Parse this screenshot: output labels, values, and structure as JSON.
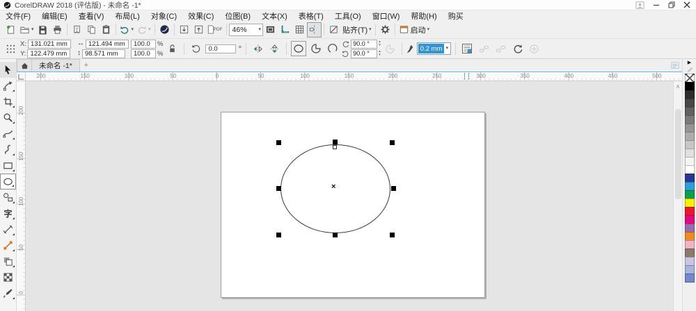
{
  "window": {
    "title": "CorelDRAW 2018 (评估版) - 未命名 -1*"
  },
  "menubar": {
    "items": [
      "文件(F)",
      "编辑(E)",
      "查看(V)",
      "布局(L)",
      "对象(C)",
      "效果(C)",
      "位图(B)",
      "文本(X)",
      "表格(T)",
      "工具(O)",
      "窗口(W)",
      "帮助(H)",
      "购买"
    ]
  },
  "toolbar": {
    "zoom_level": "46%",
    "pdf_label": "PDF",
    "snap_label": "贴齐(T)",
    "launch_label": "启动"
  },
  "property_bar": {
    "x_label": "X:",
    "x_value": "131.021 mm",
    "y_label": "Y:",
    "y_value": "122.479 mm",
    "width_value": "121.494 mm",
    "height_value": "98.571 mm",
    "scale_h": "100.0",
    "scale_v": "100.0",
    "percent": "%",
    "rotation_value": "0.0",
    "start_angle": "90.0 °",
    "end_angle": "90.0 °",
    "outline_width": "0.2 mm"
  },
  "document_tabs": {
    "active": "未命名 -1*"
  },
  "rulers": {
    "horizontal_labels": [
      "200",
      "150",
      "100",
      "50",
      "0",
      "50",
      "100",
      "150",
      "200",
      "250",
      "300",
      "350",
      "400",
      "450",
      "500"
    ],
    "vertical_labels": [
      "200",
      "150",
      "100",
      "50",
      "0"
    ]
  },
  "toolbox": {
    "text_tool_glyph": "字",
    "tools": [
      "pick-tool",
      "shape-tool",
      "crop-tool",
      "zoom-tool",
      "freehand-tool",
      "artistic-media-tool",
      "rectangle-tool",
      "ellipse-tool",
      "common-shapes-tool",
      "text-tool",
      "dimension-tool",
      "connector-tool",
      "drop-shadow-tool",
      "transparency-tool",
      "color-eyedropper-tool"
    ]
  },
  "glyphs": {
    "caret": "▾",
    "degree": "°",
    "center_mark": "×",
    "new_tab": "+",
    "palette_flyout": "▶",
    "scroll_up": "∧",
    "width_arrow": "↔",
    "height_arrow": "↕",
    "spin_up": "▴",
    "spin_down": "▾"
  },
  "palette": {
    "colors": [
      "#000000",
      "#2d2d2d",
      "#474747",
      "#616161",
      "#7a7a7a",
      "#949494",
      "#adadad",
      "#c7c7c7",
      "#e0e0e0",
      "#f5f5f5",
      "#ffffff",
      "#2b3690",
      "#2c9fd8",
      "#0f9d4f",
      "#fdf000",
      "#e8192c",
      "#e5087e",
      "#9a6eae",
      "#f08a24",
      "#f2b3c7",
      "#8a7a6a",
      "#c9c4e2",
      "#a9b4da",
      "#7488cc"
    ]
  }
}
